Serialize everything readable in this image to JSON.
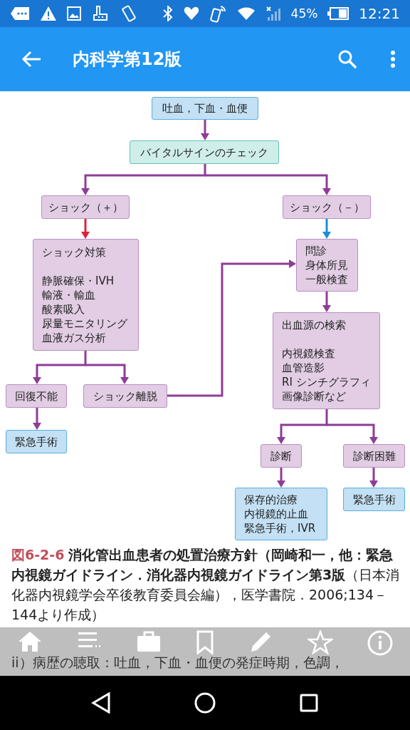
{
  "status_bar": {
    "battery": "45%",
    "time": "12:21"
  },
  "app_bar": {
    "title": "内科学第12版"
  },
  "figure": {
    "nodes": [
      {
        "kind": "start",
        "title": "吐血，下血・血便"
      },
      {
        "kind": "check",
        "title": "バイタルサインのチェック"
      },
      {
        "kind": "step",
        "title": "ショック（＋）"
      },
      {
        "kind": "step",
        "title": "ショック（－）"
      },
      {
        "kind": "step",
        "title": "ショック対策",
        "items": [
          "静脈確保・IVH",
          "輸液・輸血",
          "酸素吸入",
          "尿量モニタリング",
          "血液ガス分析"
        ]
      },
      {
        "kind": "step",
        "title": "問診",
        "items": [
          "身体所見",
          "一般検査"
        ]
      },
      {
        "kind": "step",
        "title": "回復不能"
      },
      {
        "kind": "step",
        "title": "ショック離脱"
      },
      {
        "kind": "step",
        "title": "出血源の検索",
        "items": [
          "内視鏡検査",
          "血管造影",
          "RI シンチグラフィ",
          "画像診断など"
        ]
      },
      {
        "kind": "outcome",
        "title": "緊急手術"
      },
      {
        "kind": "step",
        "title": "診断"
      },
      {
        "kind": "step",
        "title": "診断困難"
      },
      {
        "kind": "outcome",
        "title": "保存的治療",
        "items": [
          "内視鏡的止血",
          "緊急手術，IVR"
        ]
      },
      {
        "kind": "outcome",
        "title": "緊急手術"
      }
    ]
  },
  "caption": {
    "label": "図6-2-6",
    "text": "**消化管出血患者の処置治療方針（岡崎和一，他：緊急内視鏡ガイドライン．消化器内視鏡ガイドライン第3版**（日本消化器内視鏡学会卒後教育委員会編），医学書院．2006;134－144より作成）"
  },
  "body_text": "ii）病歴の聴取：吐血，下血・血便の発症時期，色調，"
}
